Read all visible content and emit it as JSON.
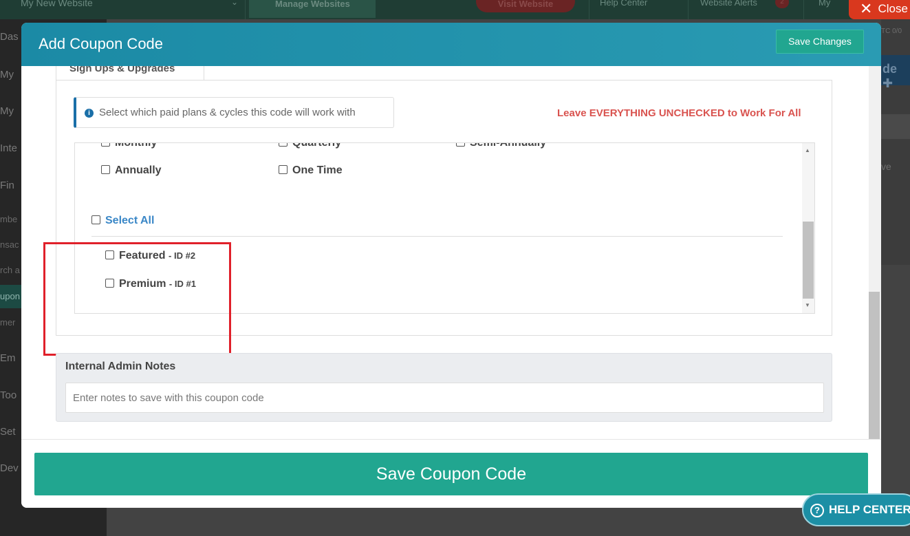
{
  "background": {
    "topbar": {
      "website_name": "My New Website",
      "manage_websites": "Manage Websites",
      "visit_website": "Visit Website",
      "help_center": "Help Center",
      "website_alerts": "Website Alerts",
      "alerts_count": "2",
      "my_account": "My"
    },
    "sidebar": {
      "items": [
        "Das",
        "My",
        "My",
        "Inte",
        "Fin",
        "mbe",
        "nsac",
        "rch a",
        "upon",
        "mer",
        "Em",
        "Too",
        "Set",
        "Dev"
      ]
    },
    "right_strip": {
      "partial_text_1": "TC 0/0",
      "partial_button": "de ✚",
      "partial_text_2": "ve"
    },
    "close_label": "Close"
  },
  "modal": {
    "title": "Add Coupon Code",
    "save_changes_label": "Save Changes",
    "tab_label": "Sign Ups & Upgrades",
    "info_text": "Select which paid plans & cycles this code will work with",
    "leave_note": "Leave EVERYTHING UNCHECKED to Work For All",
    "cycles": [
      {
        "label": "Monthly",
        "checked": false
      },
      {
        "label": "Quarterly",
        "checked": false
      },
      {
        "label": "Semi-Annually",
        "checked": false
      },
      {
        "label": "Annually",
        "checked": false
      },
      {
        "label": "One Time",
        "checked": false
      }
    ],
    "select_all_label": "Select All",
    "plans": [
      {
        "name": "Featured",
        "id_text": "- ID #2",
        "checked": false
      },
      {
        "name": "Premium",
        "id_text": "- ID #1",
        "checked": false
      }
    ],
    "notes": {
      "label": "Internal Admin Notes",
      "placeholder": "Enter notes to save with this coupon code",
      "value": ""
    },
    "save_coupon_label": "Save Coupon Code"
  },
  "help_center_label": "HELP CENTER",
  "colors": {
    "header": "#1b8aa5",
    "primary_button": "#21a690",
    "warning_text": "#d9534f",
    "link_blue": "#3a87c7",
    "highlight_red": "#e0202a"
  }
}
